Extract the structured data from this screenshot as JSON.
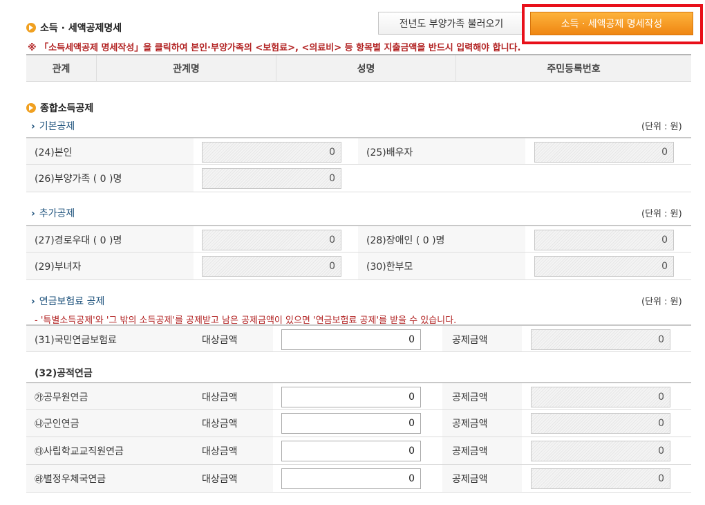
{
  "header": {
    "title": "소득 · 세액공제명세",
    "prev_button": "전년도 부양가족 불러오기",
    "main_button": "소득 · 세액공제 명세작성",
    "notice": "※ 「소득세액공제 명세작성」을 클릭하여 본인·부양가족의 <보험료>, <의료비> 등 항목별 지출금액을 반드시 입력해야 합니다."
  },
  "table": {
    "columns": [
      "관계",
      "관계명",
      "성명",
      "주민등록번호"
    ]
  },
  "income": {
    "title": "종합소득공제",
    "unit": "(단위 : 원)",
    "basic": {
      "title": "기본공제",
      "self_label": "(24)본인",
      "self_value": "0",
      "spouse_label": "(25)배우자",
      "spouse_value": "0",
      "dependents_label": "(26)부양가족 ( 0 )명",
      "dependents_value": "0"
    },
    "additional": {
      "title": "추가공제",
      "elderly_label": "(27)경로우대 ( 0 )명",
      "elderly_value": "0",
      "disabled_label": "(28)장애인 ( 0 )명",
      "disabled_value": "0",
      "woman_label": "(29)부녀자",
      "woman_value": "0",
      "single_parent_label": "(30)한부모",
      "single_parent_value": "0"
    },
    "pension": {
      "title": "연금보험료 공제",
      "desc": "- '특별소득공제'와 '그 밖의 소득공제'를 공제받고 남은 공제금액이 있으면 '연금보험료 공제'를 받을 수 있습니다.",
      "national_label": "(31)국민연금보험료",
      "target_label": "대상금액",
      "deduct_label": "공제금액",
      "national_target": "0",
      "national_deduct": "0",
      "public_title": "(32)공적연금",
      "items": [
        {
          "mark": "㉮",
          "label": "공무원연금",
          "target": "0",
          "deduct": "0"
        },
        {
          "mark": "㉯",
          "label": "군인연금",
          "target": "0",
          "deduct": "0"
        },
        {
          "mark": "㉰",
          "label": "사립학교교직원연금",
          "target": "0",
          "deduct": "0"
        },
        {
          "mark": "㉱",
          "label": "별정우체국연금",
          "target": "0",
          "deduct": "0"
        }
      ]
    }
  },
  "colors": {
    "accent": "#f0a020",
    "highlight": "#e8101a",
    "notice": "#b22222",
    "subtitle": "#1a4f7a"
  }
}
